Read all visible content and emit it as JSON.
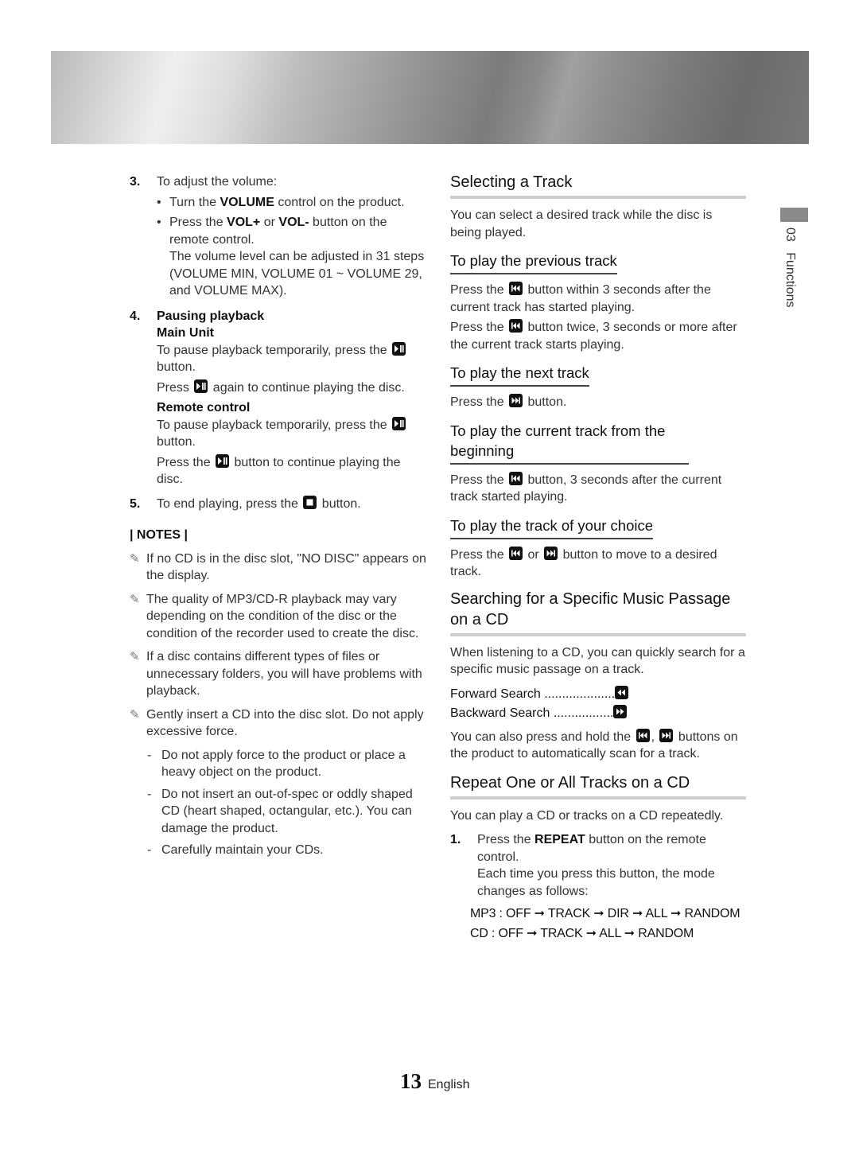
{
  "banner": {
    "name": "header-banner"
  },
  "side_tab": {
    "chapter_number": "03",
    "chapter_title": "Functions"
  },
  "left": {
    "step3": {
      "number": "3.",
      "text": "To adjust the volume:",
      "bullet1_pre": "Turn the ",
      "bullet1_bold": "VOLUME",
      "bullet1_post": " control on the product.",
      "bullet2_pre": "Press the ",
      "bullet2_bold1": "VOL+",
      "bullet2_mid": " or ",
      "bullet2_bold2": "VOL-",
      "bullet2_post": " button on the remote control.",
      "bullet2_extra": "The volume level can be adjusted in 31 steps (VOLUME MIN, VOLUME 01 ~ VOLUME 29, and VOLUME MAX)."
    },
    "step4": {
      "number": "4.",
      "title": "Pausing playback",
      "main_unit_label": "Main Unit",
      "main_unit_line1_pre": "To pause playback temporarily, press the ",
      "main_unit_line1_post": " button.",
      "main_unit_line2_pre": "Press ",
      "main_unit_line2_post": " again to continue playing the disc.",
      "remote_label": "Remote control",
      "remote_line1_pre": "To pause playback temporarily, press the ",
      "remote_line1_post": " button.",
      "remote_line2_pre": "Press the ",
      "remote_line2_post": " button to continue playing the disc."
    },
    "step5": {
      "number": "5.",
      "text_pre": "To end playing, press the ",
      "text_post": " button."
    },
    "notes_title": "| NOTES |",
    "notes": [
      "If no CD is in the disc slot, \"NO DISC\" appears on the display.",
      "The quality of MP3/CD-R playback may vary depending on the condition of the disc or the condition of the recorder used to create the disc.",
      "If a disc contains different types of files or unnecessary folders, you will have problems with playback.",
      "Gently insert a CD into the disc slot. Do not apply excessive force."
    ],
    "sub_notes": [
      "Do not apply force to the product or place a heavy object on the product.",
      "Do not insert an out-of-spec or oddly shaped CD (heart shaped, octangular, etc.). You can damage the product.",
      "Carefully maintain your CDs."
    ]
  },
  "right": {
    "selecting": {
      "title": "Selecting a Track",
      "intro": "You can select a desired track while the disc is being played."
    },
    "previous": {
      "title": "To play the previous track",
      "line1_pre": "Press the ",
      "line1_post": " button within 3 seconds after the current track has started playing.",
      "line2_pre": "Press the ",
      "line2_post": " button twice, 3 seconds or more after the current track starts playing."
    },
    "next": {
      "title": "To play the next track",
      "line_pre": "Press the ",
      "line_post": " button."
    },
    "current": {
      "title": "To play the current track from the beginning",
      "line_pre": "Press the ",
      "line_post": " button, 3 seconds after the current track started playing."
    },
    "choice": {
      "title": "To play the track of your choice",
      "line_pre": "Press the ",
      "line_mid": " or ",
      "line_post": " button to move to a desired track."
    },
    "searching": {
      "title": "Searching for a Specific Music Passage on a CD",
      "intro": "When listening to a CD, you can quickly search for a specific music passage on a track.",
      "forward_label": "Forward Search ....................",
      "backward_label": "Backward Search .................",
      "hold_pre": "You can also press and hold the ",
      "hold_mid": ", ",
      "hold_post": " buttons on the product to automatically scan for a track."
    },
    "repeat": {
      "title": "Repeat One or All Tracks on a CD",
      "intro": "You can play a CD or tracks on a CD repeatedly.",
      "step_number": "1.",
      "step_pre": "Press the ",
      "step_bold": "REPEAT",
      "step_post": " button on the remote control.",
      "step_extra": "Each time you press this button, the mode changes as follows:",
      "mp3_modes": "MP3 : OFF ➞ TRACK ➞ DIR ➞ ALL ➞ RANDOM",
      "cd_modes": "CD : OFF ➞ TRACK ➞ ALL ➞ RANDOM"
    }
  },
  "footer": {
    "page_number": "13",
    "language": "English"
  }
}
